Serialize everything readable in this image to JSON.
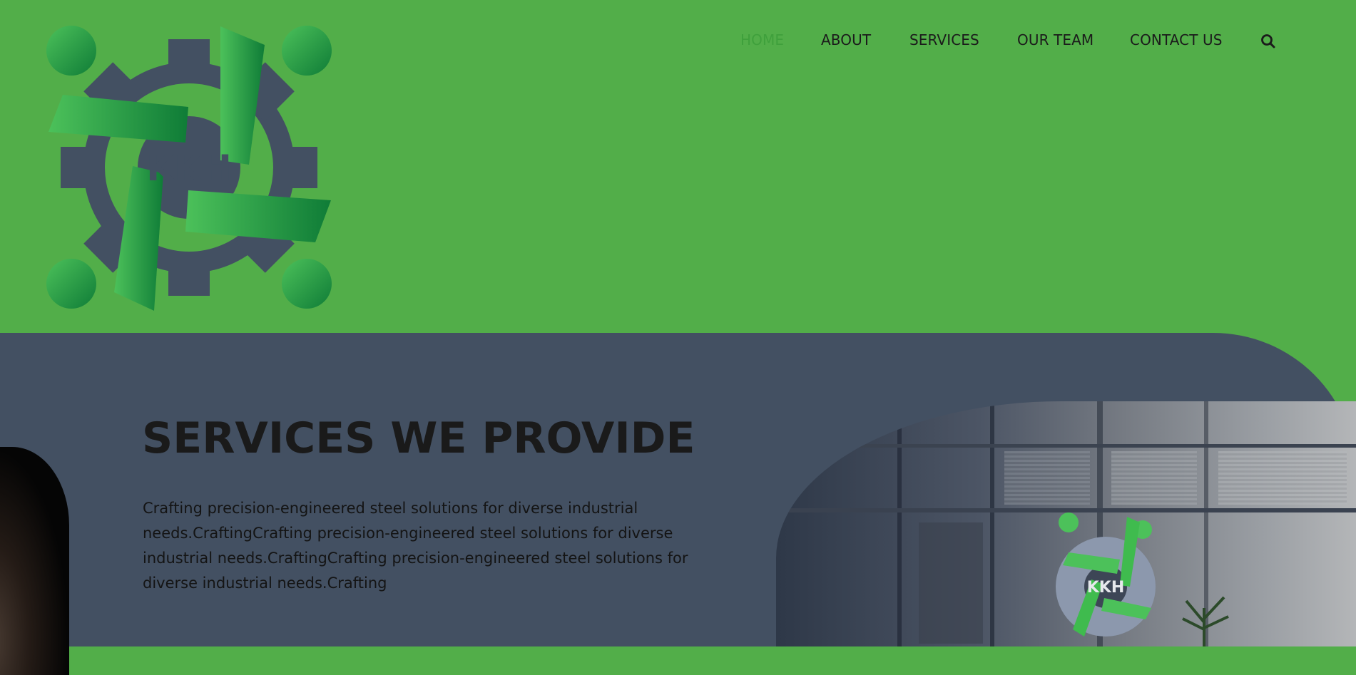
{
  "logo": {
    "text": "KKH",
    "colors": {
      "gear": "#435062",
      "green_light": "#4cc15a",
      "green_dark": "#0f7c37"
    }
  },
  "nav": {
    "items": [
      {
        "label": "HOME",
        "active": true
      },
      {
        "label": "ABOUT",
        "active": false
      },
      {
        "label": "SERVICES",
        "active": false
      },
      {
        "label": "OUR TEAM",
        "active": false
      },
      {
        "label": "CONTACT US",
        "active": false
      }
    ],
    "search_icon": "search-icon"
  },
  "services": {
    "heading": "SERVICES WE PROVIDE",
    "body": "Crafting precision-engineered steel solutions for diverse industrial needs.CraftingCrafting precision-engineered steel solutions for diverse industrial needs.CraftingCrafting precision-engineered steel solutions for diverse industrial needs.Crafting",
    "photo_sign_text": "KKH"
  },
  "colors": {
    "header_bg": "#52ae49",
    "section_bg": "#435062",
    "nav_active": "#3fa03c",
    "text_dark": "#1a1a1a"
  }
}
